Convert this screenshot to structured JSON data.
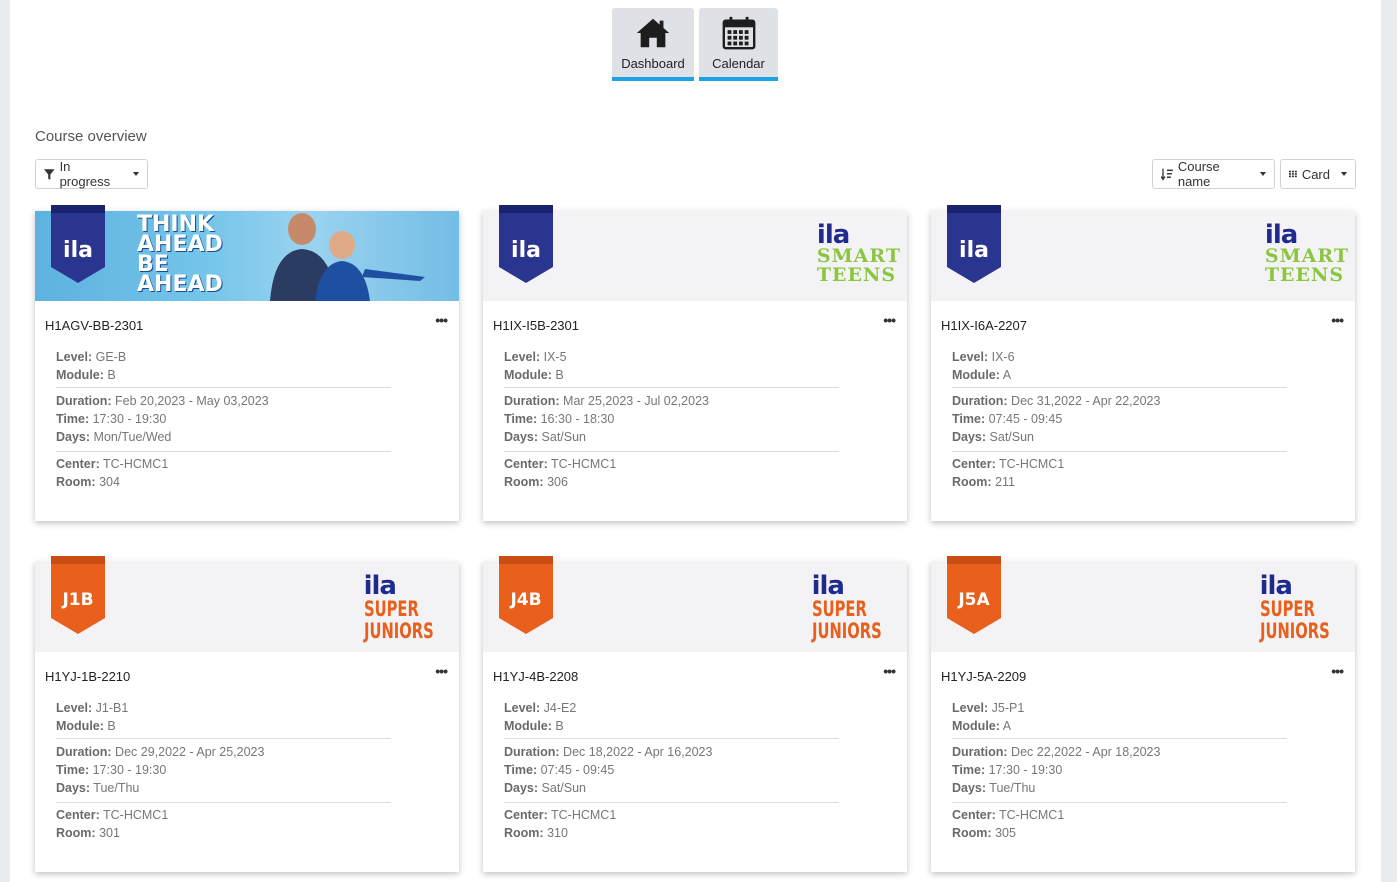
{
  "nav": {
    "dashboard_label": "Dashboard",
    "calendar_label": "Calendar"
  },
  "section_title": "Course overview",
  "filters": {
    "status_label": "In progress",
    "sort_label": "Course name",
    "view_label": "Card"
  },
  "field_labels": {
    "level": "Level:",
    "module": "Module:",
    "duration": "Duration:",
    "time": "Time:",
    "days": "Days:",
    "center": "Center:",
    "room": "Room:"
  },
  "colors": {
    "accent": "#1ea2e6",
    "ila_blue": "#1f2a8c",
    "smart_green": "#8cc63f",
    "junior_orange": "#e8601c"
  },
  "courses": [
    {
      "code": "H1AGV-BB-2301",
      "level": "GE-B",
      "module": "B",
      "duration": "Feb 20,2023 - May 03,2023",
      "time": "17:30 - 19:30",
      "days": "Mon/Tue/Wed",
      "center": "TC-HCMC1",
      "room": "304",
      "badge": "ila",
      "banner": "photo",
      "banner_text": [
        "THINK",
        "AHEAD",
        "BE",
        "AHEAD"
      ]
    },
    {
      "code": "H1IX-I5B-2301",
      "level": "IX-5",
      "module": "B",
      "duration": "Mar 25,2023 - Jul 02,2023",
      "time": "16:30 - 18:30",
      "days": "Sat/Sun",
      "center": "TC-HCMC1",
      "room": "306",
      "badge": "ila",
      "banner": "smart-teens",
      "brand_lines": [
        "ila",
        "SMART",
        "TEENS"
      ]
    },
    {
      "code": "H1IX-I6A-2207",
      "level": "IX-6",
      "module": "A",
      "duration": "Dec 31,2022 - Apr 22,2023",
      "time": "07:45 - 09:45",
      "days": "Sat/Sun",
      "center": "TC-HCMC1",
      "room": "211",
      "badge": "ila",
      "banner": "smart-teens",
      "brand_lines": [
        "ila",
        "SMART",
        "TEENS"
      ]
    },
    {
      "code": "H1YJ-1B-2210",
      "level": "J1-B1",
      "module": "B",
      "duration": "Dec 29,2022 - Apr 25,2023",
      "time": "17:30 - 19:30",
      "days": "Tue/Thu",
      "center": "TC-HCMC1",
      "room": "301",
      "badge": "J1B",
      "banner": "super-juniors",
      "brand_lines": [
        "ila",
        "SUPER",
        "JUNIORS"
      ]
    },
    {
      "code": "H1YJ-4B-2208",
      "level": "J4-E2",
      "module": "B",
      "duration": "Dec 18,2022 - Apr 16,2023",
      "time": "07:45 - 09:45",
      "days": "Sat/Sun",
      "center": "TC-HCMC1",
      "room": "310",
      "badge": "J4B",
      "banner": "super-juniors",
      "brand_lines": [
        "ila",
        "SUPER",
        "JUNIORS"
      ]
    },
    {
      "code": "H1YJ-5A-2209",
      "level": "J5-P1",
      "module": "A",
      "duration": "Dec 22,2022 - Apr 18,2023",
      "time": "17:30 - 19:30",
      "days": "Tue/Thu",
      "center": "TC-HCMC1",
      "room": "305",
      "badge": "J5A",
      "banner": "super-juniors",
      "brand_lines": [
        "ila",
        "SUPER",
        "JUNIORS"
      ]
    }
  ]
}
